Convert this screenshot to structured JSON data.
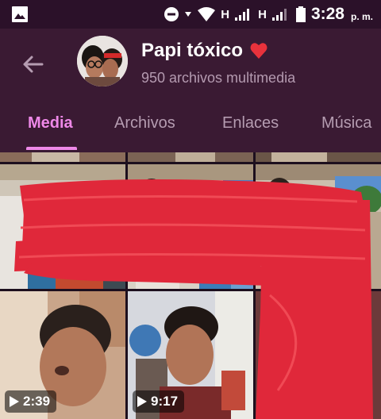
{
  "status_bar": {
    "network_left": "H",
    "network_right": "H",
    "time": "3:28",
    "ampm": "p. m."
  },
  "header": {
    "title": "Papi tóxico",
    "subtitle": "950 archivos multimedia",
    "back_icon": "arrow-left-icon",
    "heart_icon": "heart-icon"
  },
  "tabs": [
    {
      "label": "Media",
      "active": true
    },
    {
      "label": "Archivos",
      "active": false
    },
    {
      "label": "Enlaces",
      "active": false
    },
    {
      "label": "Música",
      "active": false
    }
  ],
  "media": {
    "videos": [
      {
        "duration": "2:39"
      },
      {
        "duration": "9:17"
      }
    ]
  },
  "colors": {
    "accent": "#ee88e8",
    "appbar": "#3a1a33",
    "statusbar": "#2b1129",
    "redaction": "#e0283a"
  }
}
